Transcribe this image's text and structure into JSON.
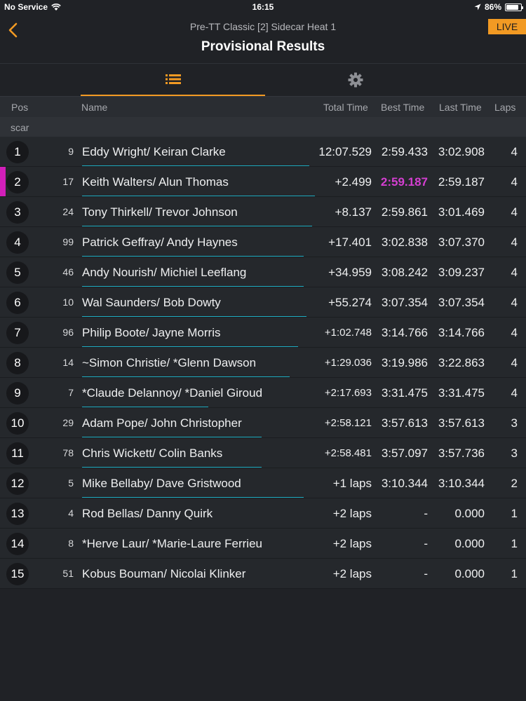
{
  "status_bar": {
    "carrier": "No Service",
    "time": "16:15",
    "battery": "86%"
  },
  "header": {
    "subtitle": "Pre-TT Classic [2] Sidecar Heat 1",
    "title": "Provisional Results",
    "live_label": "LIVE"
  },
  "colors": {
    "accent": "#f29a23",
    "fastest": "#d43fd1",
    "underline": "#1faec3"
  },
  "columns": {
    "pos": "Pos",
    "name": "Name",
    "total": "Total Time",
    "best": "Best Time",
    "last": "Last Time",
    "laps": "Laps"
  },
  "group": "scar",
  "rows": [
    {
      "pos": "1",
      "num": "9",
      "name": "Eddy Wright/ Keiran Clarke",
      "total": "12:07.529",
      "best": "2:59.433",
      "last": "3:02.908",
      "laps": "4",
      "progress": 0.81
    },
    {
      "pos": "2",
      "num": "17",
      "name": "Keith Walters/ Alun  Thomas",
      "total": "+2.499",
      "best": "2:59.187",
      "last": "2:59.187",
      "laps": "4",
      "progress": 0.83,
      "fastest_lap": true
    },
    {
      "pos": "3",
      "num": "24",
      "name": "Tony Thirkell/ Trevor  Johnson",
      "total": "+8.137",
      "best": "2:59.861",
      "last": "3:01.469",
      "laps": "4",
      "progress": 0.82
    },
    {
      "pos": "4",
      "num": "99",
      "name": "Patrick Geffray/ Andy Haynes",
      "total": "+17.401",
      "best": "3:02.838",
      "last": "3:07.370",
      "laps": "4",
      "progress": 0.79
    },
    {
      "pos": "5",
      "num": "46",
      "name": "Andy Nourish/ Michiel Leeflang",
      "total": "+34.959",
      "best": "3:08.242",
      "last": "3:09.237",
      "laps": "4",
      "progress": 0.79
    },
    {
      "pos": "6",
      "num": "10",
      "name": "Wal Saunders/ Bob Dowty",
      "total": "+55.274",
      "best": "3:07.354",
      "last": "3:07.354",
      "laps": "4",
      "progress": 0.8
    },
    {
      "pos": "7",
      "num": "96",
      "name": "Philip Boote/ Jayne Morris",
      "total": "+1:02.748",
      "best": "3:14.766",
      "last": "3:14.766",
      "laps": "4",
      "progress": 0.77
    },
    {
      "pos": "8",
      "num": "14",
      "name": "~Simon Christie/ *Glenn Dawson",
      "total": "+1:29.036",
      "best": "3:19.986",
      "last": "3:22.863",
      "laps": "4",
      "progress": 0.74
    },
    {
      "pos": "9",
      "num": "7",
      "name": "*Claude Delannoy/ *Daniel Giroud",
      "total": "+2:17.693",
      "best": "3:31.475",
      "last": "3:31.475",
      "laps": "4",
      "progress": 0.45
    },
    {
      "pos": "10",
      "num": "29",
      "name": "Adam Pope/ John Christopher",
      "total": "+2:58.121",
      "best": "3:57.613",
      "last": "3:57.613",
      "laps": "3",
      "progress": 0.64
    },
    {
      "pos": "11",
      "num": "78",
      "name": "Chris Wickett/ Colin Banks",
      "total": "+2:58.481",
      "best": "3:57.097",
      "last": "3:57.736",
      "laps": "3",
      "progress": 0.64
    },
    {
      "pos": "12",
      "num": "5",
      "name": "Mike Bellaby/ Dave Gristwood",
      "total": "+1 laps",
      "best": "3:10.344",
      "last": "3:10.344",
      "laps": "2",
      "progress": 0.79
    },
    {
      "pos": "13",
      "num": "4",
      "name": "Rod Bellas/ Danny Quirk",
      "total": "+2 laps",
      "best": "-",
      "last": "0.000",
      "laps": "1",
      "progress": 0
    },
    {
      "pos": "14",
      "num": "8",
      "name": "*Herve Laur/ *Marie-Laure Ferrieu",
      "total": "+2 laps",
      "best": "-",
      "last": "0.000",
      "laps": "1",
      "progress": 0
    },
    {
      "pos": "15",
      "num": "51",
      "name": "Kobus Bouman/ Nicolai Klinker",
      "total": "+2 laps",
      "best": "-",
      "last": "0.000",
      "laps": "1",
      "progress": 0
    }
  ]
}
